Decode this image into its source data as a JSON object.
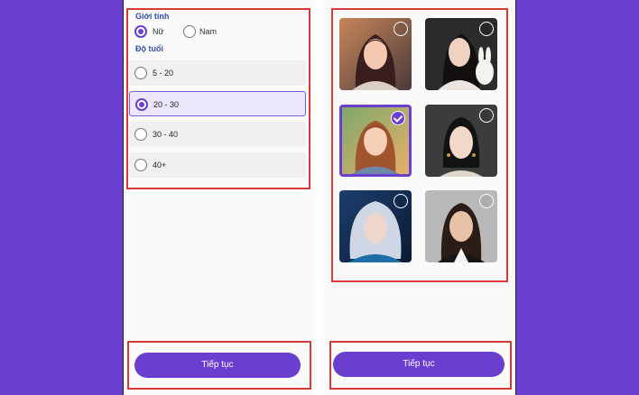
{
  "gender_section": {
    "label": "Giới tính",
    "options": [
      {
        "label": "Nữ",
        "selected": true
      },
      {
        "label": "Nam",
        "selected": false
      }
    ]
  },
  "age_section": {
    "label": "Độ tuổi",
    "options": [
      {
        "label": "5 - 20",
        "selected": false
      },
      {
        "label": "20 - 30",
        "selected": true
      },
      {
        "label": "30 - 40",
        "selected": false
      },
      {
        "label": "40+",
        "selected": false
      }
    ]
  },
  "portraits": [
    {
      "name": "portrait-1",
      "selected": false
    },
    {
      "name": "portrait-2",
      "selected": false
    },
    {
      "name": "portrait-3",
      "selected": true
    },
    {
      "name": "portrait-4",
      "selected": false
    },
    {
      "name": "portrait-5",
      "selected": false
    },
    {
      "name": "portrait-6",
      "selected": false
    }
  ],
  "buttons": {
    "left_continue": "Tiếp tục",
    "right_continue": "Tiếp tục"
  },
  "colors": {
    "accent": "#6a3fcf",
    "highlight_border": "#d83a3a",
    "label_blue": "#2f4f9f"
  }
}
